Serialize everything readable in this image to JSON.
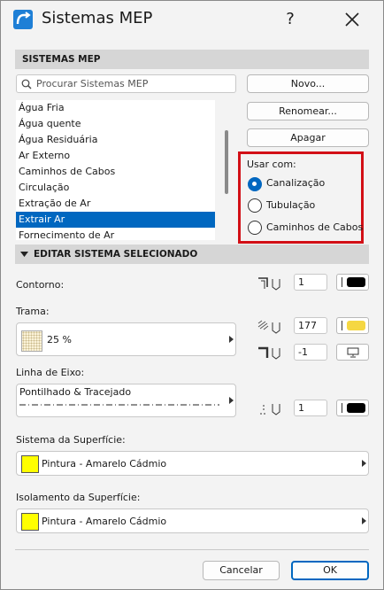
{
  "title": "Sistemas MEP",
  "help_label": "?",
  "section_main": "SISTEMAS MEP",
  "search": {
    "placeholder": "Procurar Sistemas MEP"
  },
  "buttons": {
    "novo": "Novo...",
    "renomear": "Renomear...",
    "apagar": "Apagar",
    "cancelar": "Cancelar",
    "ok": "OK"
  },
  "systems": [
    "Água Fria",
    "Água quente",
    "Água Residuária",
    "Ar Externo",
    "Caminhos de Cabos",
    "Circulação",
    "Extração de Ar",
    "Extrair Ar",
    "Fornecimento de Ar"
  ],
  "selected_system": "Extrair Ar",
  "usar_com": {
    "label": "Usar com:",
    "options": [
      "Canalização",
      "Tubulação",
      "Caminhos de Cabos"
    ],
    "selected": "Canalização"
  },
  "section_edit": "EDITAR SISTEMA SELECIONADO",
  "contorno": {
    "label": "Contorno:",
    "pen": "1",
    "color": "#000000"
  },
  "trama": {
    "label": "Trama:",
    "value": "25 %",
    "pen": "177",
    "pen_color": "#f5d742",
    "bg_pen": "-1"
  },
  "linha_eixo": {
    "label": "Linha de Eixo:",
    "value": "Pontilhado & Tracejado",
    "pen": "1",
    "color": "#000000"
  },
  "superficie": {
    "label": "Sistema da Superfície:",
    "value": "Pintura - Amarelo Cádmio",
    "color": "#ffff00"
  },
  "isolamento": {
    "label": "Isolamento da Superfície:",
    "value": "Pintura - Amarelo Cádmio",
    "color": "#ffff00"
  },
  "colors": {
    "accent": "#0067c0",
    "highlight_border": "#d20f16",
    "section_bg": "#d6d6d6"
  }
}
